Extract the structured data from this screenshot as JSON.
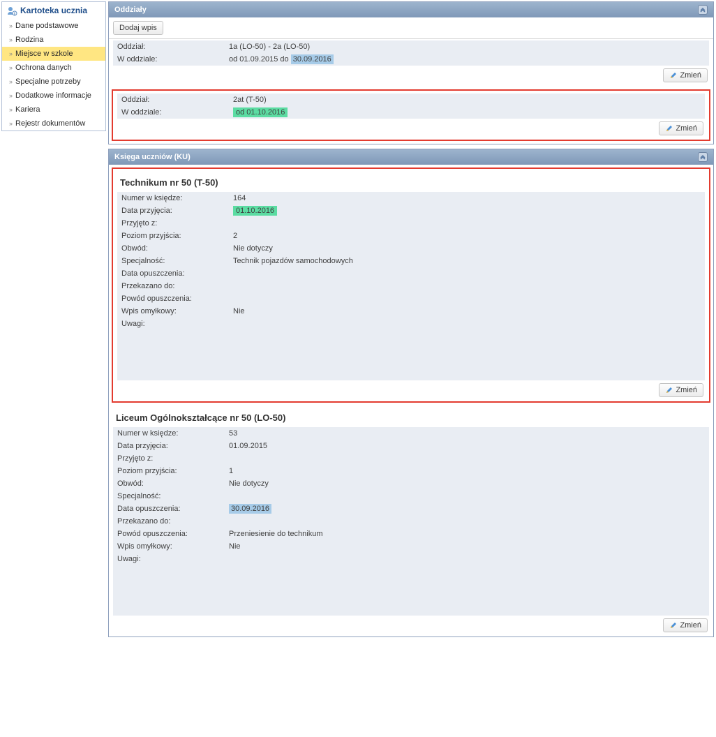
{
  "sidebar": {
    "title": "Kartoteka ucznia",
    "items": [
      {
        "label": "Dane podstawowe"
      },
      {
        "label": "Rodzina"
      },
      {
        "label": "Miejsce w szkole"
      },
      {
        "label": "Ochrona danych"
      },
      {
        "label": "Specjalne potrzeby"
      },
      {
        "label": "Dodatkowe informacje"
      },
      {
        "label": "Kariera"
      },
      {
        "label": "Rejestr dokumentów"
      }
    ]
  },
  "panels": {
    "oddzialy": {
      "title": "Oddziały",
      "add_btn": "Dodaj wpis",
      "records": [
        {
          "oddzial_label": "Oddział:",
          "oddzial_value": "1a (LO-50) - 2a (LO-50)",
          "woddziale_label": "W oddziale:",
          "woddziale_pre": "od 01.09.2015 do ",
          "woddziale_hl": "30.09.2016"
        },
        {
          "oddzial_label": "Oddział:",
          "oddzial_value": "2at (T-50)",
          "woddziale_label": "W oddziale:",
          "woddziale_hl": "od 01.10.2016"
        }
      ]
    },
    "ku": {
      "title": "Księga uczniów (KU)",
      "schools": [
        {
          "heading": "Technikum nr 50 (T-50)",
          "fields": {
            "numer_label": "Numer w księdze:",
            "numer_value": "164",
            "data_przyjecia_label": "Data przyjęcia:",
            "data_przyjecia_value": "01.10.2016",
            "przyjeto_z_label": "Przyjęto z:",
            "przyjeto_z_value": "",
            "poziom_label": "Poziom przyjścia:",
            "poziom_value": "2",
            "obwod_label": "Obwód:",
            "obwod_value": "Nie dotyczy",
            "specjalnosc_label": "Specjalność:",
            "specjalnosc_value": "Technik pojazdów samochodowych",
            "data_opuszczenia_label": "Data opuszczenia:",
            "data_opuszczenia_value": "",
            "przekazano_label": "Przekazano do:",
            "przekazano_value": "",
            "powod_label": "Powód opuszczenia:",
            "powod_value": "",
            "wpis_label": "Wpis omyłkowy:",
            "wpis_value": "Nie",
            "uwagi_label": "Uwagi:",
            "uwagi_value": ""
          }
        },
        {
          "heading": "Liceum Ogólnokształcące nr 50 (LO-50)",
          "fields": {
            "numer_label": "Numer w księdze:",
            "numer_value": "53",
            "data_przyjecia_label": "Data przyjęcia:",
            "data_przyjecia_value": "01.09.2015",
            "przyjeto_z_label": "Przyjęto z:",
            "przyjeto_z_value": "",
            "poziom_label": "Poziom przyjścia:",
            "poziom_value": "1",
            "obwod_label": "Obwód:",
            "obwod_value": "Nie dotyczy",
            "specjalnosc_label": "Specjalność:",
            "specjalnosc_value": "",
            "data_opuszczenia_label": "Data opuszczenia:",
            "data_opuszczenia_value": "30.09.2016",
            "przekazano_label": "Przekazano do:",
            "przekazano_value": "",
            "powod_label": "Powód opuszczenia:",
            "powod_value": "Przeniesienie do technikum",
            "wpis_label": "Wpis omyłkowy:",
            "wpis_value": "Nie",
            "uwagi_label": "Uwagi:",
            "uwagi_value": ""
          }
        }
      ]
    }
  },
  "buttons": {
    "zmien": "Zmień"
  }
}
